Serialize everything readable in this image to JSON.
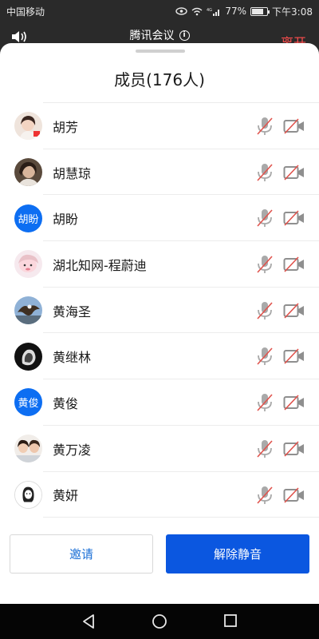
{
  "status_bar": {
    "carrier": "中国移动",
    "battery_percent": "77%",
    "battery_level": 0.77,
    "time": "下午3:08",
    "icons": [
      "eye-icon",
      "wifi-icon",
      "4g-signal-icon",
      "battery-icon"
    ]
  },
  "meeting_header": {
    "app_title": "腾讯会议",
    "leave_label": "离开"
  },
  "panel": {
    "title": "成员(176人)"
  },
  "members": [
    {
      "name": "胡芳",
      "avatar": "photo",
      "avatar_text": ""
    },
    {
      "name": "胡慧琼",
      "avatar": "photo",
      "avatar_text": ""
    },
    {
      "name": "胡盼",
      "avatar": "text",
      "avatar_text": "胡盼"
    },
    {
      "name": "湖北知网-程蔚迪",
      "avatar": "photo",
      "avatar_text": ""
    },
    {
      "name": "黄海圣",
      "avatar": "photo",
      "avatar_text": ""
    },
    {
      "name": "黄继林",
      "avatar": "photo",
      "avatar_text": ""
    },
    {
      "name": "黄俊",
      "avatar": "text",
      "avatar_text": "黄俊"
    },
    {
      "name": "黄万凌",
      "avatar": "photo",
      "avatar_text": ""
    },
    {
      "name": "黄妍",
      "avatar": "photo",
      "avatar_text": ""
    }
  ],
  "actions": {
    "invite_label": "邀请",
    "unmute_all_label": "解除静音"
  },
  "colors": {
    "primary_blue": "#0b57e0",
    "invite_text": "#1b6fd6",
    "leave_red": "#ff4d4d",
    "muted_slash": "#e0534d"
  }
}
